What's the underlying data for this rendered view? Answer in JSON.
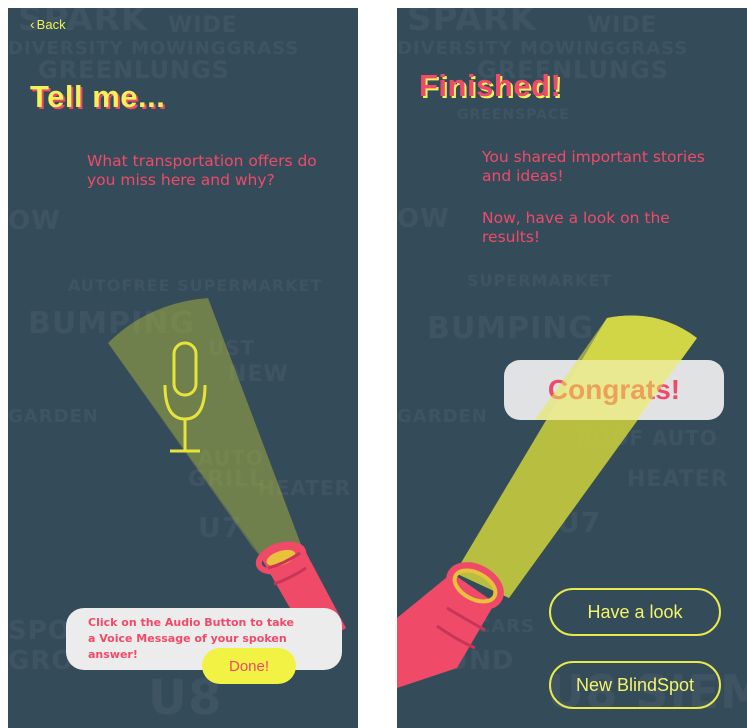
{
  "screen_left": {
    "back_label": "Back",
    "heading": "Tell me...",
    "question": "What transportation offers do you miss here and why?",
    "hint": "Click on the Audio Button to take a Voice Message of your spoken answer!",
    "done_label": "Done!",
    "mic_icon": "microphone-icon"
  },
  "screen_right": {
    "heading": "Finished!",
    "message_1": "You shared important stories and ideas!",
    "message_2": "Now, have a look on the results!",
    "congrats_label": "Congrats!",
    "have_look_label": "Have a look",
    "new_blindspot_label": "New BlindSpot"
  },
  "colors": {
    "background": "#344b59",
    "accent_yellow": "#f3f25a",
    "accent_pink": "#f04a69",
    "bubble": "#ececec"
  }
}
